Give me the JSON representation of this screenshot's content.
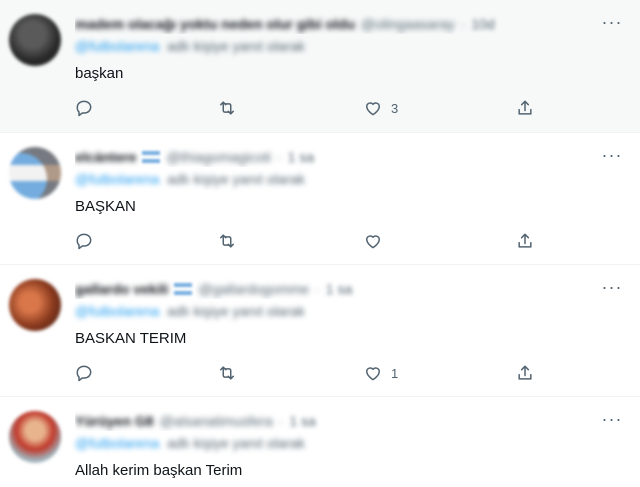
{
  "tweets": [
    {
      "display_name": "madem olacağı yoktu neden olur gibi oldu",
      "handle": "@olingaasaray",
      "time": "10d",
      "reply_mention": "@futbolarena",
      "reply_text": "adlı kişiye yanıt olarak",
      "text": "başkan",
      "likes": "3",
      "has_flag": false,
      "avatar_color": "#2a2a2a"
    },
    {
      "display_name": "elcántere",
      "handle": "@thiagomagicoti",
      "time": "1 sa",
      "reply_mention": "@futbolarena",
      "reply_text": "adlı kişiye yanıt olarak",
      "text": "BAŞKAN",
      "likes": "",
      "has_flag": true,
      "avatar_color": "#74acdf"
    },
    {
      "display_name": "gallardo vekili",
      "handle": "@gallardogomme",
      "time": "1 sa",
      "reply_mention": "@futbolarena",
      "reply_text": "adlı kişiye yanıt olarak",
      "text": "BASKAN TERIM",
      "likes": "1",
      "has_flag": true,
      "avatar_color": "#8b3a1e"
    },
    {
      "display_name": "Yürüyen G8",
      "handle": "@alsanatimusfera",
      "time": "1 sa",
      "reply_mention": "@futbolarena",
      "reply_text": "adlı kişiye yanıt olarak",
      "text": "Allah kerim başkan Terim",
      "likes": "",
      "has_flag": false,
      "avatar_color": "#c0392b"
    }
  ],
  "icons": {
    "more": "more-dots-icon",
    "reply": "reply-icon",
    "retweet": "retweet-icon",
    "like": "heart-icon",
    "share": "share-icon"
  },
  "colors": {
    "text": "#0f1419",
    "secondary": "#536471",
    "accent": "#1d9bf0",
    "divider": "#eff3f4",
    "highlight_bg": "#f7f9f9"
  }
}
